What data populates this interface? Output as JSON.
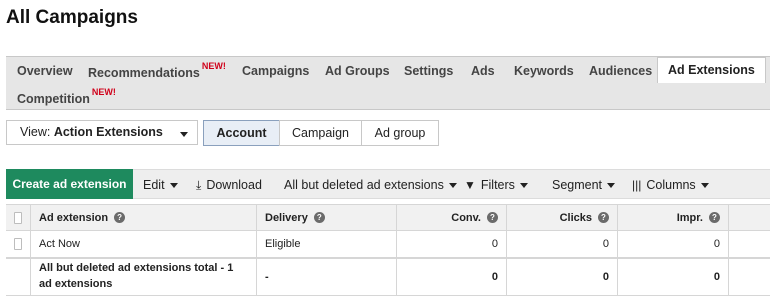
{
  "page": {
    "title": "All Campaigns"
  },
  "tabs": [
    {
      "label": "Overview"
    },
    {
      "label": "Recommendations",
      "badge": "NEW!"
    },
    {
      "label": "Campaigns"
    },
    {
      "label": "Ad Groups"
    },
    {
      "label": "Settings"
    },
    {
      "label": "Ads"
    },
    {
      "label": "Keywords"
    },
    {
      "label": "Audiences"
    },
    {
      "label": "Ad Extensions",
      "active": true
    },
    {
      "label": "Competition",
      "badge": "NEW!"
    }
  ],
  "view": {
    "prefix": "View:",
    "value": "Action Extensions"
  },
  "level_tabs": [
    "Account",
    "Campaign",
    "Ad group"
  ],
  "toolbar": {
    "create": "Create ad extension",
    "edit": "Edit",
    "download": "Download",
    "filter_set": "All but deleted ad extensions",
    "filters": "Filters",
    "segment": "Segment",
    "columns": "Columns"
  },
  "table": {
    "headers": [
      "Ad extension",
      "Delivery",
      "Conv.",
      "Clicks",
      "Impr."
    ],
    "rows": [
      {
        "name": "Act Now",
        "delivery": "Eligible",
        "conv": "0",
        "clicks": "0",
        "impr": "0"
      }
    ],
    "total": {
      "label": "All but deleted ad extensions total - 1 ad extensions",
      "delivery": "-",
      "conv": "0",
      "clicks": "0",
      "impr": "0"
    }
  },
  "colors": {
    "primary_button": "#1e8a5e",
    "badge": "#d0021b",
    "active_segment": "#e8eef6"
  },
  "icons": [
    "caret-down-icon",
    "download-icon",
    "filter-icon",
    "columns-icon",
    "help-icon"
  ]
}
